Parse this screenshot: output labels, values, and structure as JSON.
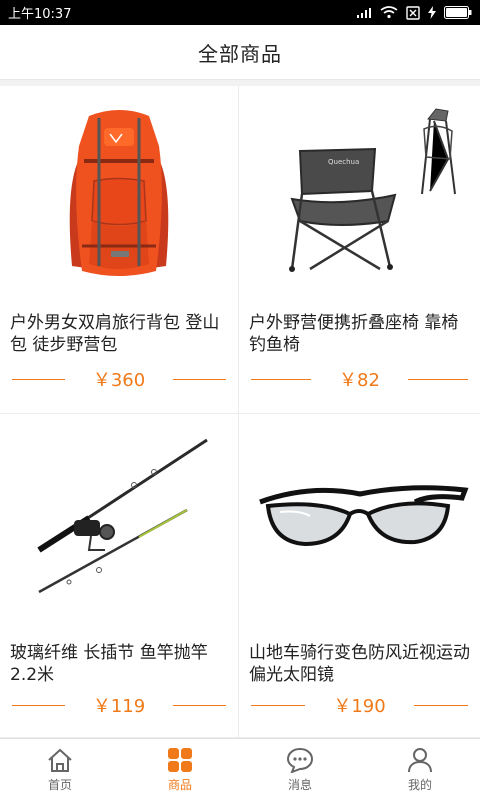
{
  "status_bar": {
    "time": "上午10:37"
  },
  "header": {
    "title": "全部商品"
  },
  "products": [
    {
      "title": "户外男女双肩旅行背包 登山包 徒步野营包",
      "price": "￥360",
      "icon": "backpack-image"
    },
    {
      "title": "户外野营便携折叠座椅 靠椅钓鱼椅",
      "price": "￥82",
      "icon": "folding-chair-image"
    },
    {
      "title": "玻璃纤维 长插节 鱼竿抛竿2.2米",
      "price": "￥119",
      "icon": "fishing-rod-image"
    },
    {
      "title": "山地车骑行变色防风近视运动偏光太阳镜",
      "price": "￥190",
      "icon": "sunglasses-image"
    }
  ],
  "tabbar": {
    "items": [
      {
        "label": "首页",
        "icon": "home-icon"
      },
      {
        "label": "商品",
        "icon": "grid-icon"
      },
      {
        "label": "消息",
        "icon": "chat-icon"
      },
      {
        "label": "我的",
        "icon": "user-icon"
      }
    ],
    "active": 1,
    "accent": "#f07a1a"
  }
}
